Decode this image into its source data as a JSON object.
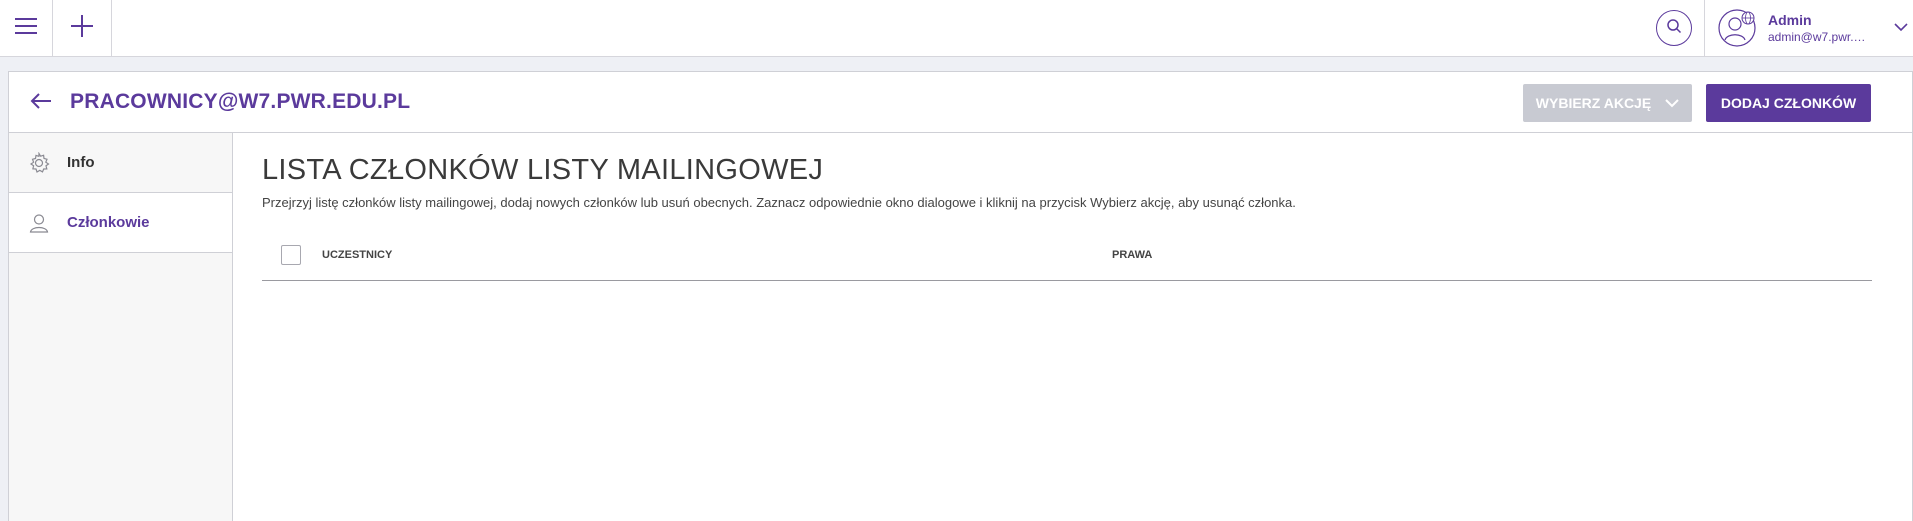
{
  "topbar": {
    "menu_icon": "hamburger-icon",
    "add_icon": "plus-icon",
    "search_icon": "search-icon"
  },
  "user": {
    "name": "Admin",
    "email": "admin@w7.pwr.e...",
    "avatar_icon": "user-globe-icon",
    "chevron_icon": "chevron-down-icon"
  },
  "header": {
    "title": "PRACOWNICY@W7.PWR.EDU.PL",
    "back_icon": "arrow-left-icon",
    "action_label": "WYBIERZ AKCJĘ",
    "add_members_label": "DODAJ CZŁONKÓW"
  },
  "sidebar": {
    "items": [
      {
        "label": "Info",
        "icon": "gear-icon",
        "active": false
      },
      {
        "label": "Członkowie",
        "icon": "user-icon",
        "active": true
      }
    ]
  },
  "main": {
    "title": "LISTA CZŁONKÓW LISTY MAILINGOWEJ",
    "description": "Przejrzyj listę członków listy mailingowej, dodaj nowych członków lub usuń obecnych. Zaznacz odpowiednie okno dialogowe i kliknij na przycisk Wybierz akcję, aby usunąć członka.",
    "columns": [
      "UCZESTNICY",
      "PRAWA"
    ],
    "rows": []
  },
  "colors": {
    "accent": "#5b3a9c",
    "disabled_button": "#c8cad2",
    "background": "#eef0f5"
  }
}
